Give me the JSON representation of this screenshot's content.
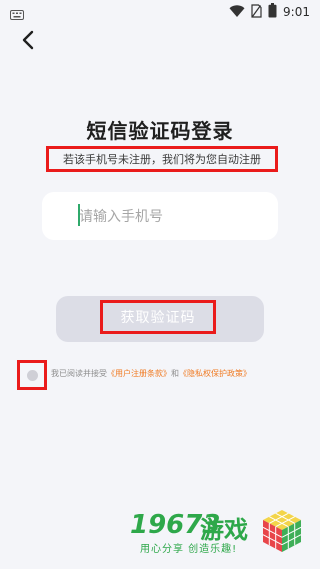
{
  "status_bar": {
    "time": "9:01",
    "icons": [
      "keyboard-icon",
      "wifi-icon",
      "sim-icon",
      "battery-icon"
    ]
  },
  "nav": {
    "back_icon": "chevron-left-icon"
  },
  "login": {
    "title": "短信验证码登录",
    "subtitle": "若该手机号未注册，我们将为您自动注册",
    "phone_placeholder": "请输入手机号",
    "get_code_label": "获取验证码"
  },
  "agreement": {
    "prefix": "我已阅读并接受",
    "user_terms": "《用户注册条款》",
    "and": "和",
    "privacy": "《隐私权保护政策》"
  },
  "watermark": {
    "number": "19673",
    "name": "游戏",
    "slogan": "用心分享  创造乐趣!"
  },
  "colors": {
    "accent": "#f07a22",
    "highlight_border": "#ea1b1b",
    "watermark_green": "#2ea84a",
    "button_disabled": "#dcdde6",
    "background": "#f4f5f9"
  }
}
